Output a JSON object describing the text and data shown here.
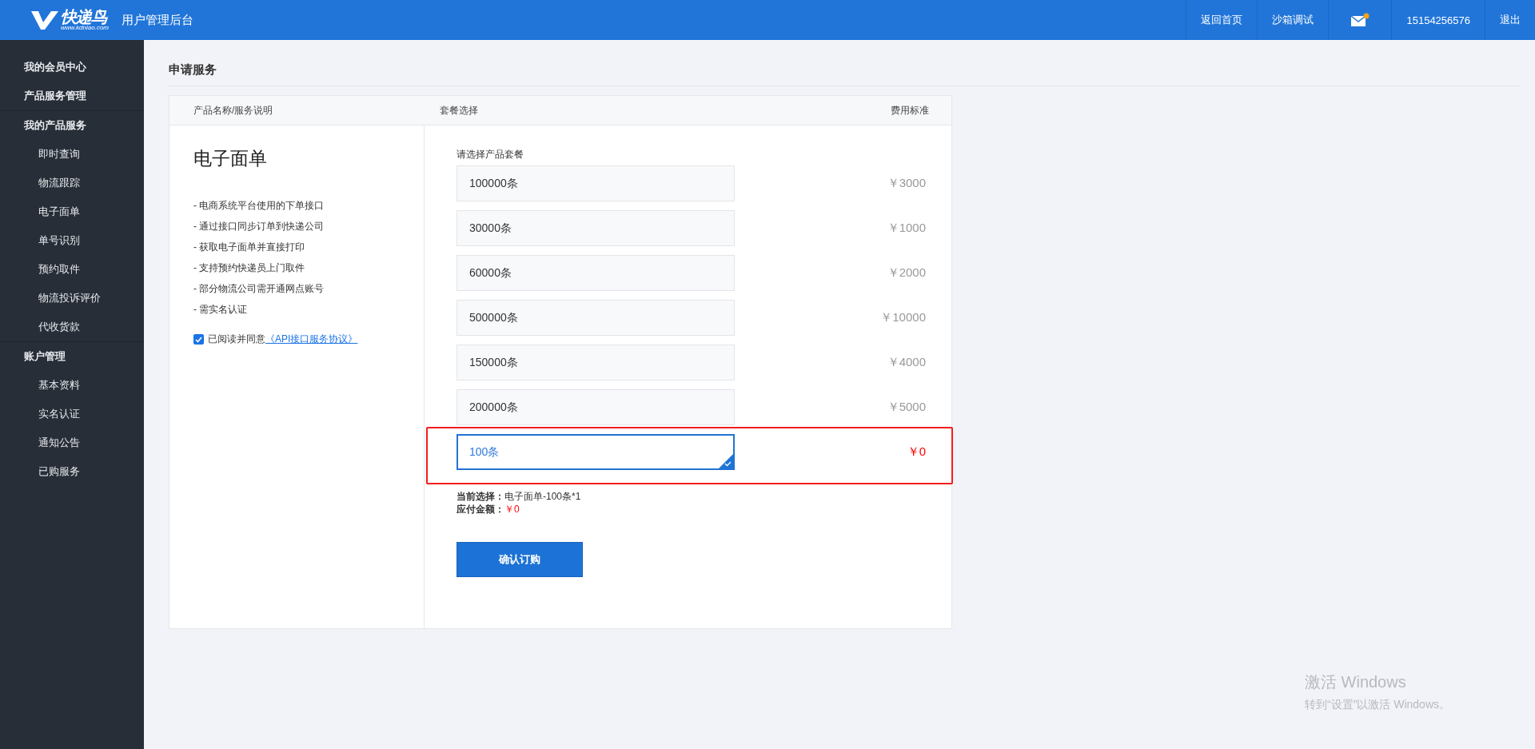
{
  "header": {
    "logo": {
      "brand": "快递鸟",
      "url": "www.kdniao.com"
    },
    "title": "用户管理后台",
    "links": [
      {
        "kind": "text",
        "label": "返回首页"
      },
      {
        "kind": "text",
        "label": "沙箱调试"
      },
      {
        "kind": "mail",
        "unread": true
      },
      {
        "kind": "text",
        "label": "15154256576"
      },
      {
        "kind": "text",
        "label": "退出"
      }
    ]
  },
  "sidebar": {
    "groups": [
      {
        "label": "我的会员中心"
      },
      {
        "label": "产品服务管理"
      },
      {
        "label": "我的产品服务",
        "children": [
          "即时查询",
          "物流跟踪",
          "电子面单",
          "单号识别",
          "预约取件",
          "物流投诉评价",
          "代收货款"
        ]
      },
      {
        "label": "账户管理",
        "children": [
          "基本资料",
          "实名认证",
          "通知公告",
          "已购服务"
        ]
      }
    ]
  },
  "page_title": "申请服务",
  "table": {
    "columns": [
      "产品名称/服务说明",
      "套餐选择",
      "费用标准"
    ],
    "product": {
      "name": "电子面单",
      "features": [
        "- 电商系统平台使用的下单接口",
        "- 通过接口同步订单到快递公司",
        "- 获取电子面单并直接打印",
        "- 支持预约快递员上门取件",
        "- 部分物流公司需开通网点账号",
        "- 需实名认证"
      ],
      "agree": {
        "checked": true,
        "label": "已阅读并同意",
        "link": "《API接口服务协议》"
      }
    },
    "package_prompt": "请选择产品套餐",
    "packages": [
      {
        "label": "100000条",
        "price": "￥3000",
        "selected": false,
        "highlighted": false
      },
      {
        "label": "30000条",
        "price": "￥1000",
        "selected": false,
        "highlighted": false
      },
      {
        "label": "60000条",
        "price": "￥2000",
        "selected": false,
        "highlighted": false
      },
      {
        "label": "500000条",
        "price": "￥10000",
        "selected": false,
        "highlighted": false
      },
      {
        "label": "150000条",
        "price": "￥4000",
        "selected": false,
        "highlighted": false
      },
      {
        "label": "200000条",
        "price": "￥5000",
        "selected": false,
        "highlighted": false
      },
      {
        "label": "100条",
        "price": "￥0",
        "selected": true,
        "highlighted": true
      }
    ],
    "summary": {
      "selection_label": "当前选择：",
      "selection": "电子面单-100条*1",
      "amount_label": "应付金额：",
      "amount": "￥0"
    },
    "confirm_button": "确认订购"
  },
  "os_notice": {
    "title": "激活 Windows",
    "hint": "转到“设置”以激活 Windows。"
  }
}
